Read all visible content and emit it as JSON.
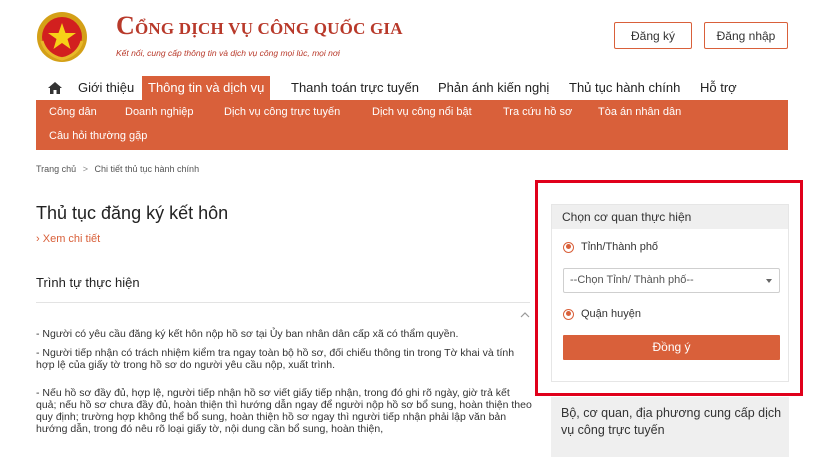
{
  "header": {
    "brand_first_letter": "C",
    "brand_rest": "ỔNG DỊCH VỤ CÔNG QUỐC GIA",
    "tagline": "Kết nối, cung cấp thông tin và dịch vụ công mọi lúc, mọi nơi",
    "register_label": "Đăng ký",
    "login_label": "Đăng nhập"
  },
  "main_nav": {
    "items": [
      {
        "label": "Giới thiệu"
      },
      {
        "label": "Thông tin và dịch vụ"
      },
      {
        "label": "Thanh toán trực tuyến"
      },
      {
        "label": "Phản ánh kiến nghị"
      },
      {
        "label": "Thủ tục hành chính"
      },
      {
        "label": "Hỗ trợ"
      }
    ],
    "active_index": 1
  },
  "sub_nav": {
    "items": [
      {
        "label": "Công dân"
      },
      {
        "label": "Doanh nghiệp"
      },
      {
        "label": "Dịch vụ công trực tuyến"
      },
      {
        "label": "Dịch vụ công nổi bật"
      },
      {
        "label": "Tra cứu hồ sơ"
      },
      {
        "label": "Tòa án nhân dân"
      },
      {
        "label": "Câu hỏi thường gặp"
      }
    ]
  },
  "breadcrumb": {
    "home": "Trang chủ",
    "separator": ">",
    "current": "Chi tiết thủ tục hành chính"
  },
  "main": {
    "title": "Thủ tục đăng ký kết hôn",
    "detail_link": "Xem chi tiết",
    "detail_bullet": "›",
    "section_title": "Trình tự thực hiện",
    "paragraphs": [
      "- Người có yêu cầu đăng ký kết hôn nộp hồ sơ tại Ủy ban nhân dân cấp xã có thẩm quyền.",
      "- Người tiếp nhận có trách nhiệm kiểm tra ngay toàn bộ hồ sơ, đối chiếu thông tin trong Tờ khai và tính hợp lệ của giấy tờ trong hồ sơ do người yêu cầu nộp, xuất trình.",
      "- Nếu hồ sơ đầy đủ, hợp lệ, người tiếp nhận hồ sơ viết giấy tiếp nhận, trong đó ghi rõ ngày, giờ trả kết quả; nếu hồ sơ chưa đầy đủ, hoàn thiện thì hướng dẫn ngay để người nộp hồ sơ bổ sung, hoàn thiện theo quy định; trường hợp không thể bổ sung, hoàn thiện hồ sơ ngay thì người tiếp nhận phải lập văn bản hướng dẫn, trong đó nêu rõ loại giấy tờ, nội dung cần bổ sung, hoàn thiện,"
    ]
  },
  "side_panel": {
    "title": "Chọn cơ quan thực hiện",
    "option_province": "Tỉnh/Thành phố",
    "select_placeholder": "--Chọn Tỉnh/ Thành phố--",
    "option_district": "Quận huyện",
    "submit_label": "Đồng ý"
  },
  "side_panel_2": {
    "title": "Bộ, cơ quan, địa phương cung cấp dịch vụ công trực tuyến"
  },
  "colors": {
    "accent": "#d9603a",
    "brand_red": "#b8392a",
    "highlight": "#e0001b"
  }
}
